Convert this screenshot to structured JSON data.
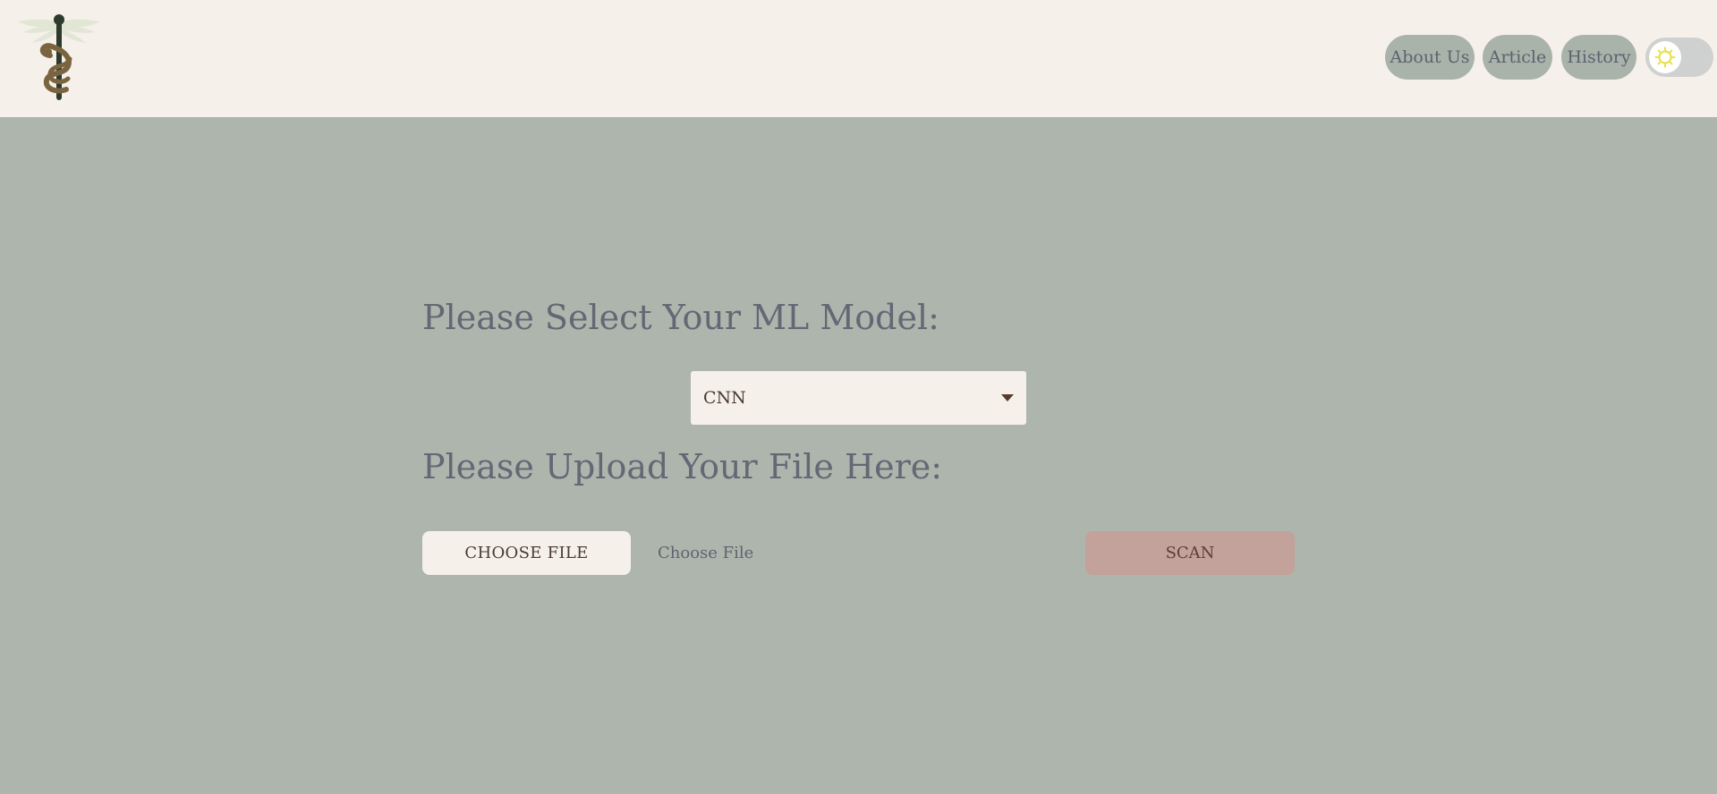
{
  "header": {
    "logo_icon": "caduceus-icon",
    "nav": {
      "about": "About Us",
      "article": "Article",
      "history": "History"
    },
    "theme_toggle": {
      "icon": "sun-icon",
      "state": "light"
    }
  },
  "main": {
    "model_heading": "Please Select Your ML Model:",
    "model_select": {
      "value": "CNN"
    },
    "upload_heading": "Please Upload Your File Here:",
    "choose_file_button": "CHOOSE FILE",
    "file_label": "Choose File",
    "scan_button": "SCAN"
  },
  "colors": {
    "background": "#adb5ad",
    "header": "#f5f0ea",
    "nav_button": "#aab3aa",
    "scan_button": "#c2a29a",
    "heading_text": "#636874"
  }
}
